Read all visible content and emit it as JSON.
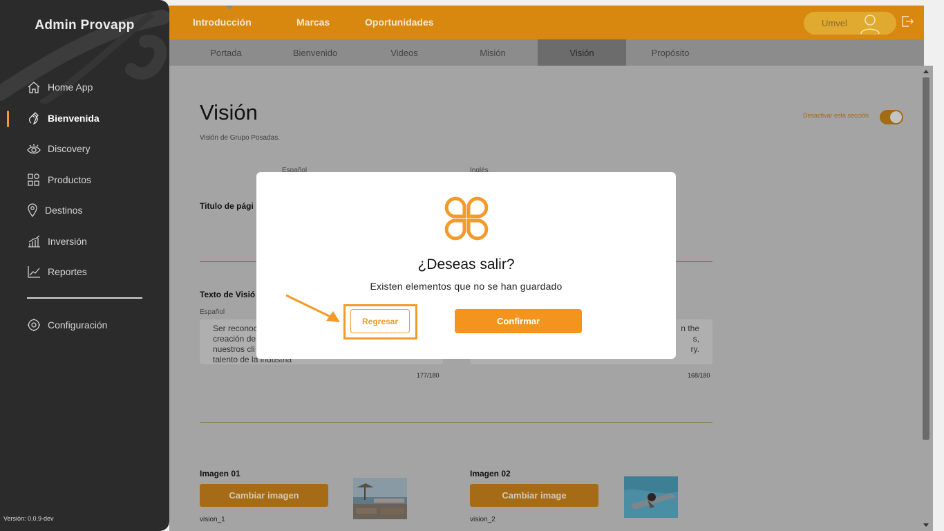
{
  "sidebar": {
    "title": "Admin Provapp",
    "items": [
      {
        "label": "Home App",
        "icon": "home-icon"
      },
      {
        "label": "Bienvenida",
        "icon": "waving-hand-icon",
        "active": true
      },
      {
        "label": "Discovery",
        "icon": "eye-icon"
      },
      {
        "label": "Productos",
        "icon": "products-grid-icon"
      },
      {
        "label": "Destinos",
        "icon": "location-pin-icon"
      },
      {
        "label": "Inversión",
        "icon": "growth-bars-icon"
      },
      {
        "label": "Reportes",
        "icon": "line-chart-icon"
      }
    ],
    "settings_label": "Configuración",
    "version": "Versión: 0.0.9-dev"
  },
  "topbar": {
    "tabs": [
      "Introducción",
      "Marcas",
      "Oportunidades"
    ],
    "user_name": "Umvel"
  },
  "subtabs": [
    "Portada",
    "Bienvenido",
    "Videos",
    "Misión",
    "Visión",
    "Propósito"
  ],
  "subtabs_active": "Visión",
  "main": {
    "title": "Visión",
    "subtitle": "Visión de Grupo Posadas.",
    "toggle_label": "Desactivar esta sección",
    "col_es": "Español",
    "col_en": "Inglés",
    "page_title_label": "Titulo de pági",
    "text_label": "Texto de Visió",
    "text_col_es": "Español",
    "text_es": "Ser reconoc\ncreación de\nnuestros cli\ntalento de la industria",
    "text_en": "n the\ns,\nry.",
    "counter_es": "177/180",
    "counter_en": "168/180",
    "images": [
      {
        "label": "Imagen 01",
        "button": "Cambiar imagen",
        "name": "vision_1"
      },
      {
        "label": "Imagen 02",
        "button": "Cambiar image",
        "name": "vision_2"
      }
    ]
  },
  "modal": {
    "title": "¿Deseas salir?",
    "message": "Existen elementos que no se han guardado",
    "back_label": "Regresar",
    "confirm_label": "Confirmar"
  },
  "colors": {
    "accent": "#f39a27",
    "topbar": "#d9880f",
    "sidebar": "#2b2b2b"
  }
}
